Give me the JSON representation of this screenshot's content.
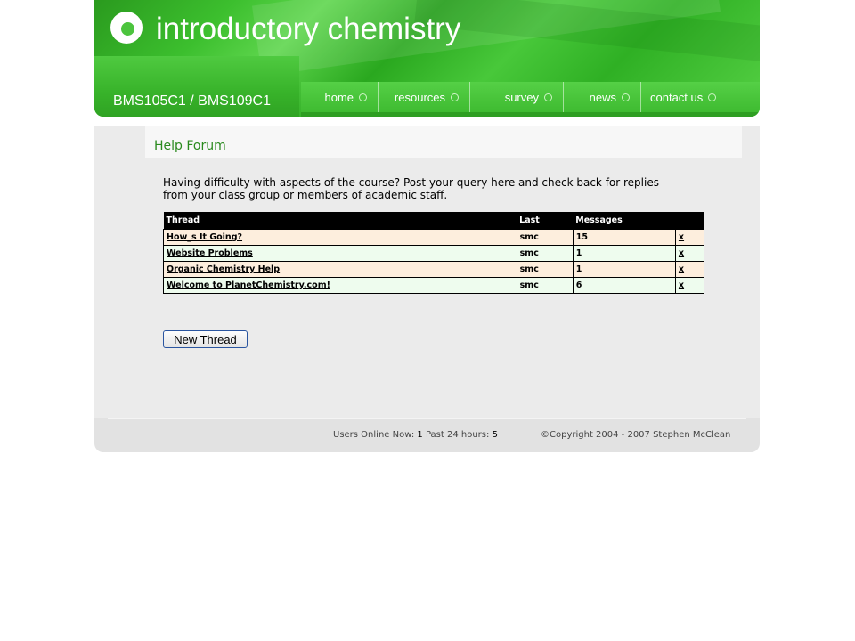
{
  "header": {
    "site_title": "introductory chemistry",
    "course_code": "BMS105C1 / BMS109C1"
  },
  "nav": {
    "items": [
      {
        "label": "home"
      },
      {
        "label": "resources"
      },
      {
        "label": "survey"
      },
      {
        "label": "news"
      },
      {
        "label": "contact us"
      }
    ]
  },
  "main": {
    "page_title": "Help Forum",
    "intro_line1": "Having difficulty with aspects of the course? Post your query here and check back for replies",
    "intro_line2": "from your class group or members of academic staff.",
    "table": {
      "headers": [
        "Thread",
        "Last",
        "Messages",
        ""
      ],
      "rows": [
        {
          "thread": "How_s It Going?",
          "last": "smc",
          "messages": "15",
          "action": "x"
        },
        {
          "thread": "Website Problems",
          "last": "smc",
          "messages": "1",
          "action": "x"
        },
        {
          "thread": "Organic Chemistry Help",
          "last": "smc",
          "messages": "1",
          "action": "x"
        },
        {
          "thread": "Welcome to PlanetChemistry.com!",
          "last": "smc",
          "messages": "6",
          "action": "x"
        }
      ]
    },
    "new_thread_label": "New Thread"
  },
  "footer": {
    "users_online_label": "Users Online Now:",
    "users_online_value": "1",
    "past_24_label": "Past 24 hours:",
    "past_24_value": "5",
    "copyright": "©Copyright 2004 - 2007 Stephen McClean"
  }
}
